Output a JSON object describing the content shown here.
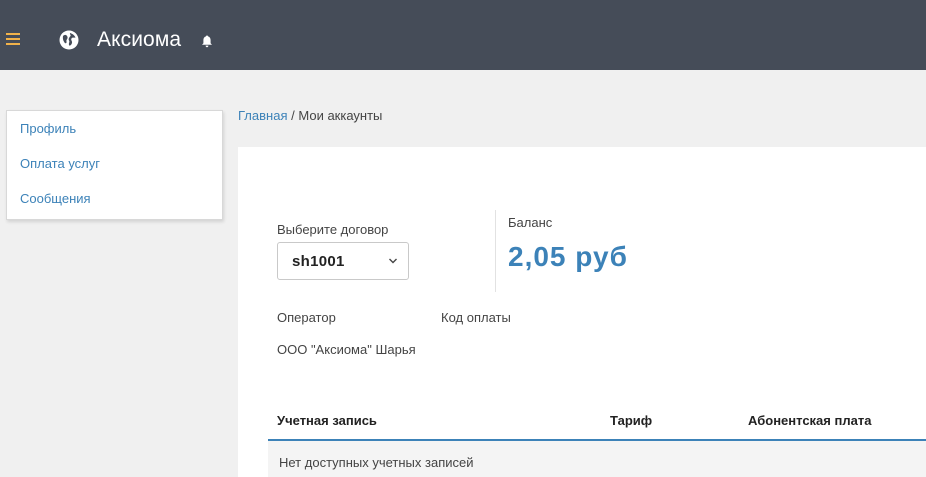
{
  "header": {
    "brand": "Аксиома",
    "icons": [
      "menu-icon",
      "globe-icon",
      "bell-icon"
    ],
    "colors": {
      "bar": "#454c58",
      "menu_icon": "#f1b24a"
    }
  },
  "sidebar": {
    "items": [
      {
        "label": "Профиль"
      },
      {
        "label": "Оплата услуг"
      },
      {
        "label": "Сообщения"
      }
    ]
  },
  "breadcrumb": {
    "home": "Главная",
    "separator": "/",
    "current": "Мои аккаунты"
  },
  "contract": {
    "label": "Выберите договор",
    "selected": "sh1001"
  },
  "balance": {
    "label": "Баланс",
    "value": "2,05 руб"
  },
  "operator": {
    "label": "Оператор",
    "name": "ООО \"Аксиома\" Шарья"
  },
  "payment_code": {
    "label": "Код оплаты"
  },
  "accounts_table": {
    "columns": [
      "Учетная запись",
      "Тариф",
      "Абонентская плата"
    ],
    "empty_message": "Нет доступных учетных записей"
  },
  "theme": {
    "accent": "#3c82b8"
  }
}
